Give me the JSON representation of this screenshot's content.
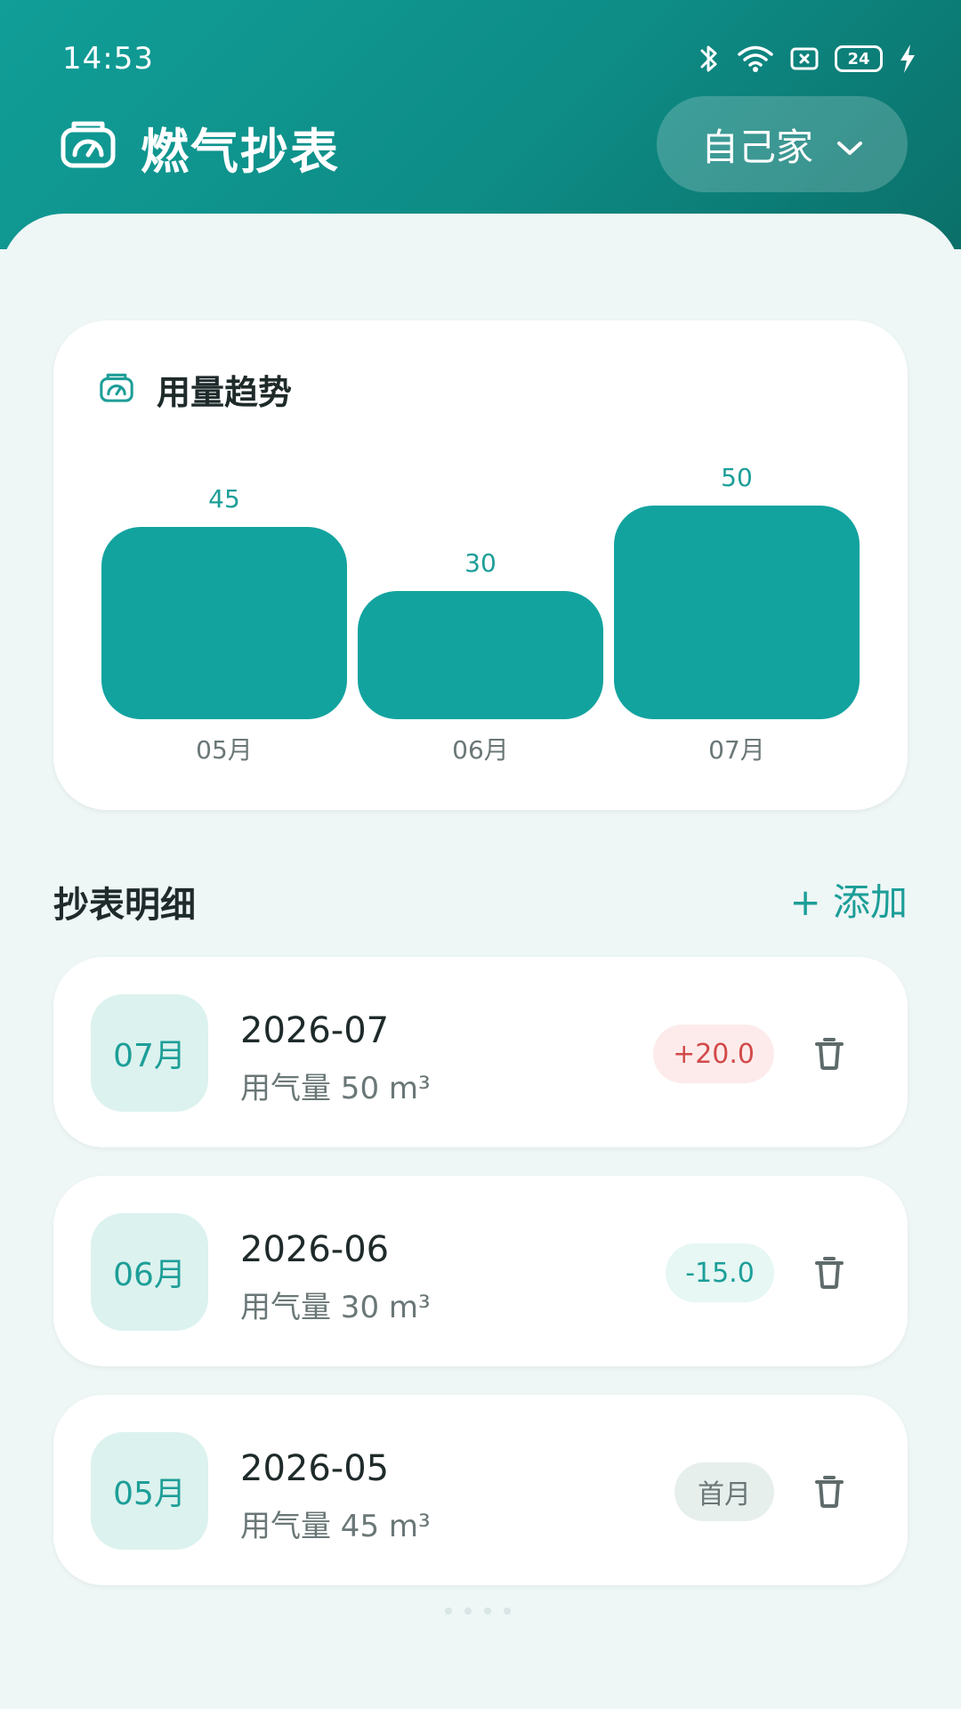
{
  "status_bar": {
    "time": "14:53",
    "battery": "24",
    "icons": [
      "bluetooth-icon",
      "wifi-icon",
      "sim-icon",
      "battery-icon",
      "charging-icon"
    ]
  },
  "header": {
    "title": "燃气抄表",
    "icon": "gas-meter-icon",
    "selector_label": "自己家",
    "selector_icon": "chevron-down-icon",
    "gradient_colors": [
      "#119e98",
      "#0b6f69"
    ]
  },
  "chart_card": {
    "title": "用量趋势",
    "icon": "gas-meter-icon"
  },
  "chart_data": {
    "type": "bar",
    "categories": [
      "05月",
      "06月",
      "07月"
    ],
    "values": [
      45,
      30,
      50
    ],
    "title": "用量趋势",
    "xlabel": "",
    "ylabel": "",
    "ylim": [
      0,
      50
    ],
    "bar_color": "#12a39f",
    "value_label_color": "#1d9e98",
    "grid": false
  },
  "list": {
    "title": "抄表明细",
    "add_label": "+ 添加",
    "records": [
      {
        "month": "07月",
        "date": "2026-07",
        "usage": "用气量 50 m³",
        "diff": "+20.0",
        "diff_type": "up"
      },
      {
        "month": "06月",
        "date": "2026-06",
        "usage": "用气量 30 m³",
        "diff": "-15.0",
        "diff_type": "down"
      },
      {
        "month": "05月",
        "date": "2026-05",
        "usage": "用气量 45 m³",
        "diff": "首月",
        "diff_type": "first"
      }
    ]
  },
  "colors": {
    "accent": "#1d9e98",
    "increase": "#d24a4a",
    "background": "#eef6f6"
  }
}
